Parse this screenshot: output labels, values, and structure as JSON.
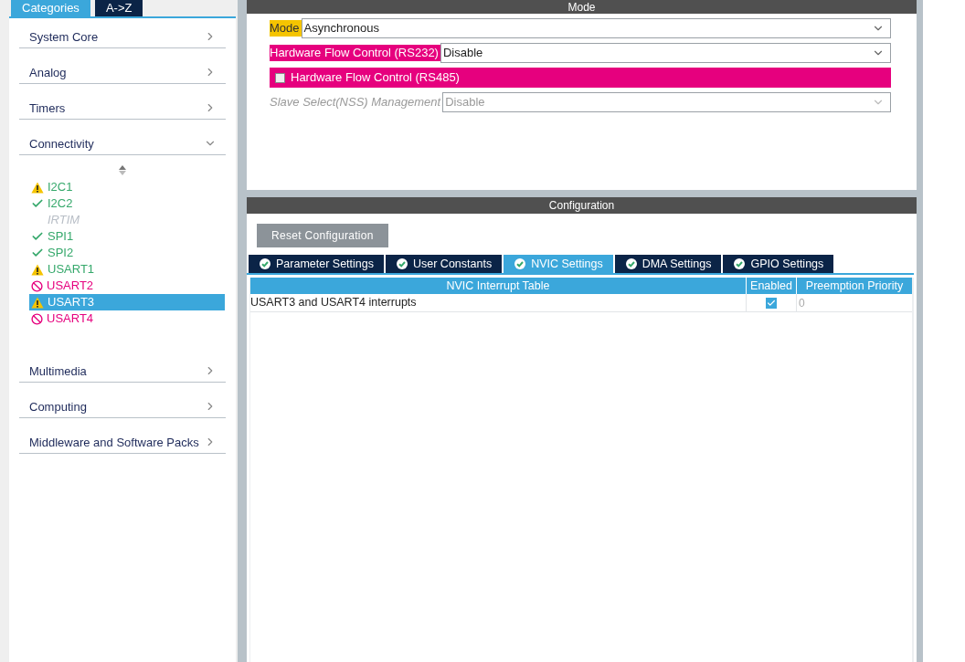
{
  "sidebar": {
    "tabs": [
      {
        "label": "Categories",
        "selected": true
      },
      {
        "label": "A->Z",
        "selected": false
      }
    ],
    "categories_top": [
      {
        "label": "System Core",
        "expanded": false
      },
      {
        "label": "Analog",
        "expanded": false
      },
      {
        "label": "Timers",
        "expanded": false
      },
      {
        "label": "Connectivity",
        "expanded": true
      }
    ],
    "items": [
      {
        "label": "I2C1",
        "kind": "warning",
        "selected": false
      },
      {
        "label": "I2C2",
        "kind": "ok",
        "selected": false
      },
      {
        "label": "IRTIM",
        "kind": "disabled",
        "selected": false
      },
      {
        "label": "SPI1",
        "kind": "ok",
        "selected": false
      },
      {
        "label": "SPI2",
        "kind": "ok",
        "selected": false
      },
      {
        "label": "USART1",
        "kind": "warning",
        "selected": false
      },
      {
        "label": "USART2",
        "kind": "blocked",
        "selected": false
      },
      {
        "label": "USART3",
        "kind": "warning",
        "selected": true
      },
      {
        "label": "USART4",
        "kind": "blocked",
        "selected": false
      }
    ],
    "categories_bottom": [
      {
        "label": "Multimedia",
        "expanded": false
      },
      {
        "label": "Computing",
        "expanded": false
      },
      {
        "label": "Middleware and Software Packs",
        "expanded": false
      }
    ]
  },
  "mode": {
    "title": "Mode",
    "fields": [
      {
        "kind": "select",
        "label": "Mode",
        "color": "#f5c400",
        "disabled": false,
        "value": "Asynchronous"
      },
      {
        "kind": "select",
        "label": "Hardware Flow Control (RS232)",
        "color": "#e6007e",
        "disabled": false,
        "value": "Disable"
      },
      {
        "kind": "checkbox",
        "label": "Hardware Flow Control (RS485)",
        "color": "#e6007e",
        "checked": false
      },
      {
        "kind": "select",
        "label": "Slave Select(NSS) Management",
        "disabled": true,
        "value": "Disable"
      }
    ]
  },
  "configuration": {
    "title": "Configuration",
    "reset_button": "Reset Configuration",
    "tabs": [
      {
        "label": "Parameter Settings",
        "selected": false
      },
      {
        "label": "User Constants",
        "selected": false
      },
      {
        "label": "NVIC Settings",
        "selected": true
      },
      {
        "label": "DMA Settings",
        "selected": false
      },
      {
        "label": "GPIO Settings",
        "selected": false
      }
    ],
    "table": {
      "columns": [
        "NVIC Interrupt Table",
        "Enabled",
        "Preemption Priority"
      ],
      "rows": [
        {
          "name": "USART3 and USART4 interrupts",
          "enabled": true,
          "priority": "0"
        }
      ]
    }
  }
}
